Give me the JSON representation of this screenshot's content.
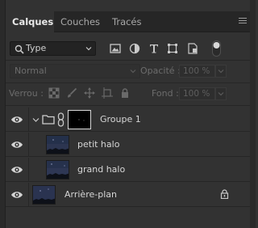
{
  "tabs": [
    {
      "label": "Calques",
      "active": true
    },
    {
      "label": "Couches",
      "active": false
    },
    {
      "label": "Tracés",
      "active": false
    }
  ],
  "filter": {
    "kind_label": "Type",
    "icons": [
      "image-filter-icon",
      "adjustment-filter-icon",
      "type-filter-icon",
      "shape-filter-icon",
      "smart-object-filter-icon",
      "filter-toggle-icon"
    ]
  },
  "blend": {
    "mode_label": "Normal",
    "opacity_label": "Opacité :",
    "opacity_value": "100 %",
    "fill_label": "Fond :",
    "fill_value": "100 %"
  },
  "locks": {
    "label": "Verrou :",
    "icons": [
      "lock-transparent-icon",
      "lock-image-icon",
      "lock-position-icon",
      "lock-artboard-icon",
      "lock-all-icon"
    ]
  },
  "layers": [
    {
      "name": "Groupe 1",
      "type": "group",
      "visible": true,
      "expanded": true
    },
    {
      "name": "petit halo",
      "type": "pixel",
      "visible": true,
      "indented": true
    },
    {
      "name": "grand halo",
      "type": "pixel",
      "visible": true,
      "indented": true
    },
    {
      "name": "Arrière-plan",
      "type": "background",
      "visible": true,
      "locked": true
    }
  ],
  "colors": {
    "panel_bg": "#323232",
    "tabbar_bg": "#262626",
    "text": "#d6d6d6",
    "muted": "#6c6c6c"
  }
}
